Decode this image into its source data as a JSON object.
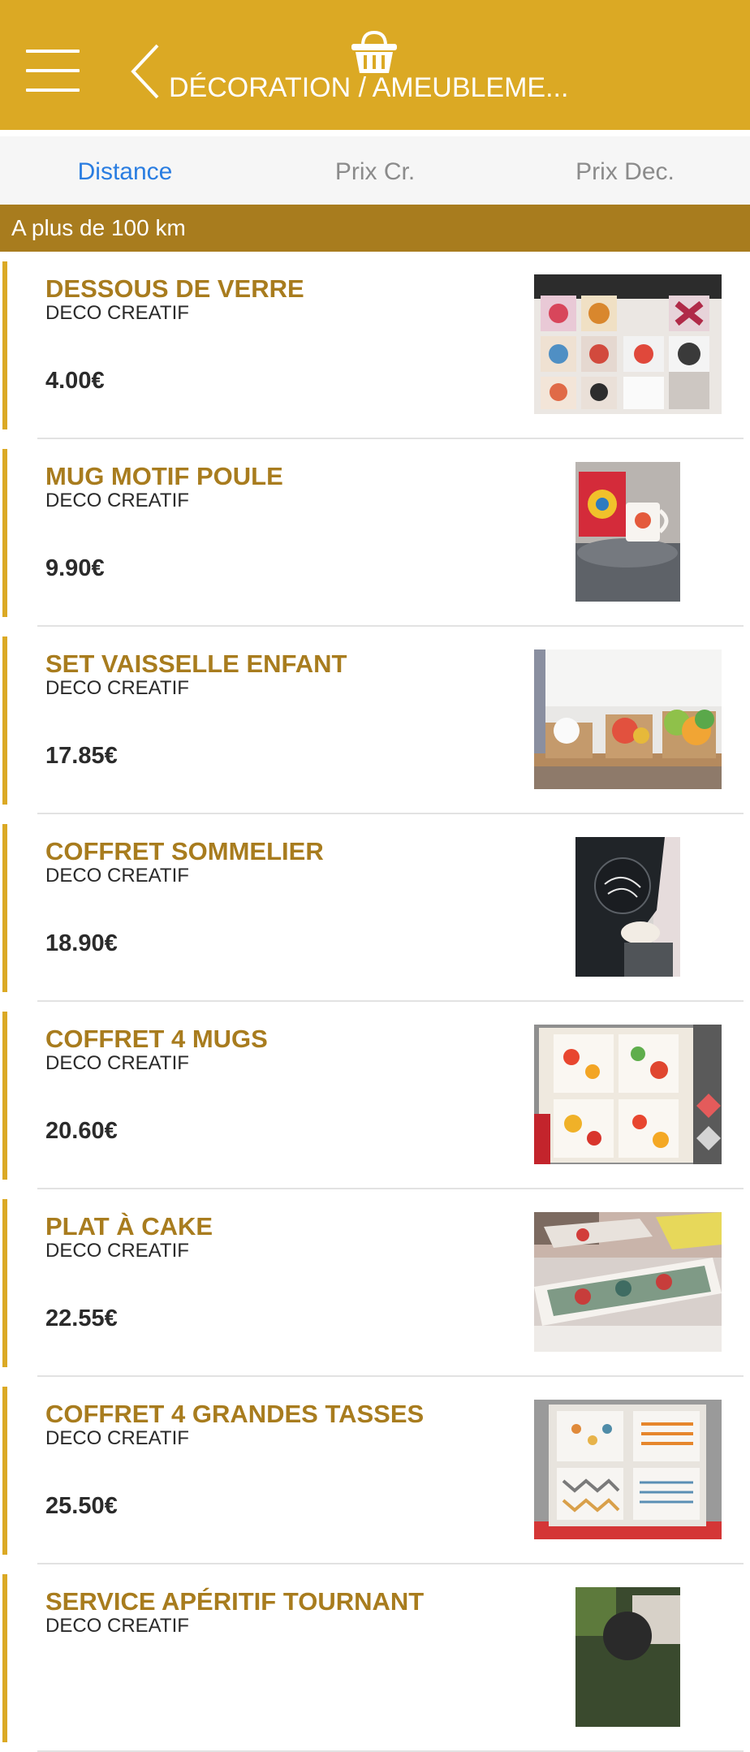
{
  "header": {
    "title": "DÉCORATION / AMEUBLEME...",
    "background_color": "#dba924",
    "icons": [
      "menu-icon",
      "back-arrow-icon",
      "basket-icon"
    ]
  },
  "tabs": [
    {
      "label": "Distance",
      "active": true
    },
    {
      "label": "Prix Cr.",
      "active": false
    },
    {
      "label": "Prix Dec.",
      "active": false
    }
  ],
  "section": {
    "label": "A plus de 100 km"
  },
  "items": [
    {
      "name": "DESSOUS DE VERRE",
      "shop": "DECO CREATIF",
      "price": "4.00€",
      "image": "coasters-photo"
    },
    {
      "name": "MUG MOTIF POULE",
      "shop": "DECO CREATIF",
      "price": "9.90€",
      "image": "hen-mug-photo"
    },
    {
      "name": "SET VAISSELLE ENFANT",
      "shop": "DECO CREATIF",
      "price": "17.85€",
      "image": "kids-tableware-photo"
    },
    {
      "name": "COFFRET SOMMELIER",
      "shop": "DECO CREATIF",
      "price": "18.90€",
      "image": "sommelier-box-photo"
    },
    {
      "name": "COFFRET 4 MUGS",
      "shop": "DECO CREATIF",
      "price": "20.60€",
      "image": "mugs-box-photo"
    },
    {
      "name": "PLAT À CAKE",
      "shop": "DECO CREATIF",
      "price": "22.55€",
      "image": "cake-plate-photo"
    },
    {
      "name": "COFFRET 4 GRANDES TASSES",
      "shop": "DECO CREATIF",
      "price": "25.50€",
      "image": "large-cups-box-photo"
    },
    {
      "name": "SERVICE APÉRITIF TOURNANT",
      "shop": "DECO CREATIF",
      "price": "",
      "image": "aperitif-service-photo"
    }
  ],
  "colors": {
    "accent": "#dba924",
    "section": "#a87c1e",
    "active_tab": "#2a7de1",
    "item_title": "#a87c1e"
  }
}
